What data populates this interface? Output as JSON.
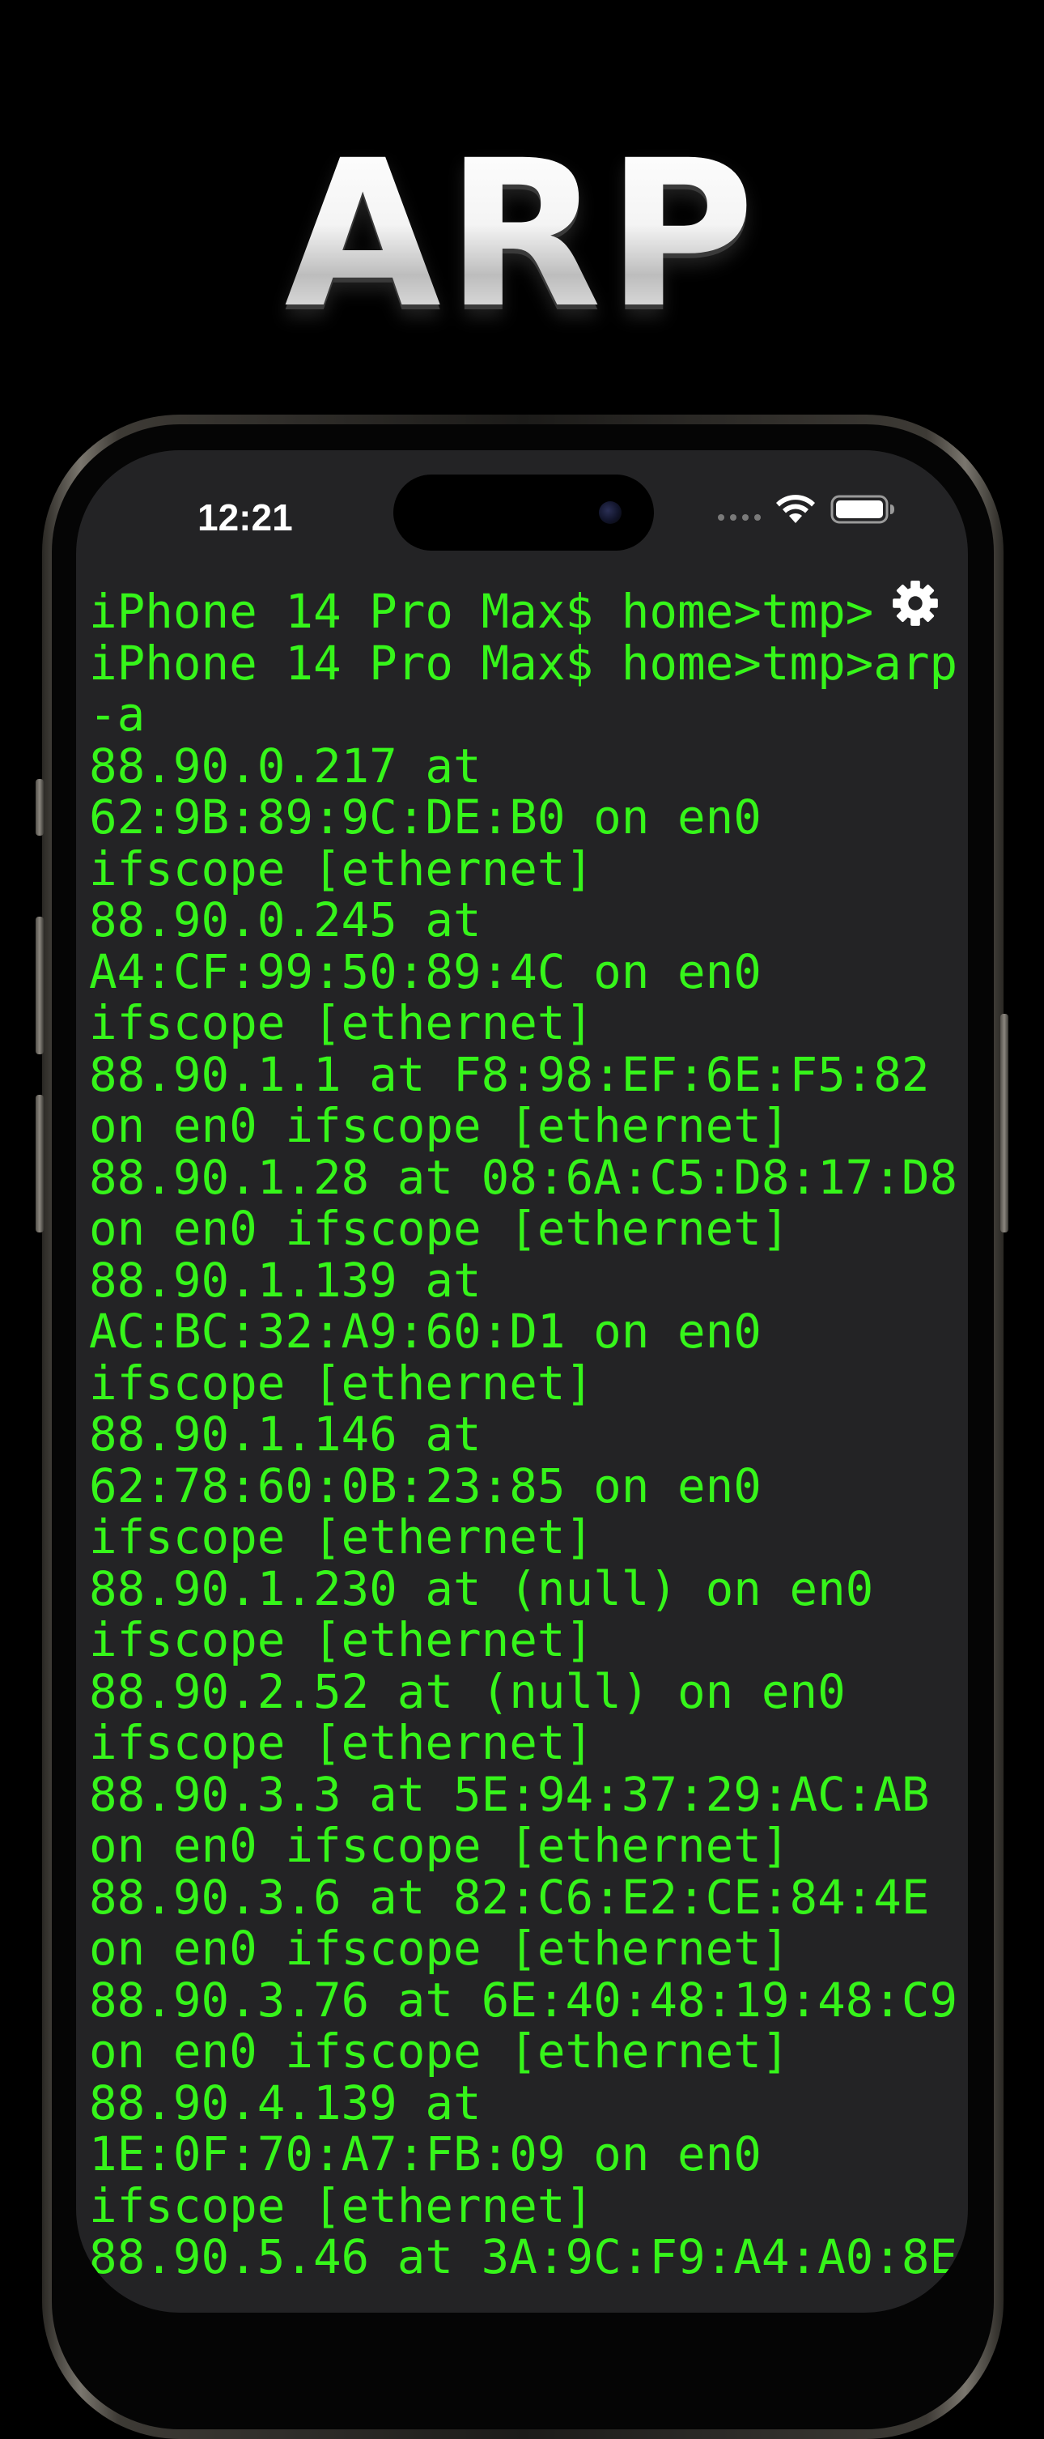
{
  "banner": {
    "title": "ARP"
  },
  "status_bar": {
    "time": "12:21",
    "icons": [
      "cellular-dots-icon",
      "wifi-icon",
      "battery-icon"
    ]
  },
  "toolbar": {
    "settings_icon": "gear-icon"
  },
  "terminal": {
    "text_color": "#36f51a",
    "background": "#232325",
    "lines": [
      "iPhone 14 Pro Max$ home>tmp>",
      "iPhone 14 Pro Max$ home>tmp>arp",
      "-a",
      "88.90.0.217 at",
      "62:9B:89:9C:DE:B0 on en0",
      "ifscope [ethernet]",
      "88.90.0.245 at",
      "A4:CF:99:50:89:4C on en0",
      "ifscope [ethernet]",
      "88.90.1.1 at F8:98:EF:6E:F5:82",
      "on en0 ifscope [ethernet]",
      "88.90.1.28 at 08:6A:C5:D8:17:D8",
      "on en0 ifscope [ethernet]",
      "88.90.1.139 at",
      "AC:BC:32:A9:60:D1 on en0",
      "ifscope [ethernet]",
      "88.90.1.146 at",
      "62:78:60:0B:23:85 on en0",
      "ifscope [ethernet]",
      "88.90.1.230 at (null) on en0",
      "ifscope [ethernet]",
      "88.90.2.52 at (null) on en0",
      "ifscope [ethernet]",
      "88.90.3.3 at 5E:94:37:29:AC:AB",
      "on en0 ifscope [ethernet]",
      "88.90.3.6 at 82:C6:E2:CE:84:4E",
      "on en0 ifscope [ethernet]",
      "88.90.3.76 at 6E:40:48:19:48:C9",
      "on en0 ifscope [ethernet]",
      "88.90.4.139 at",
      "1E:0F:70:A7:FB:09 on en0",
      "ifscope [ethernet]",
      "88.90.5.46 at 3A:9C:F9:A4:A0:8E"
    ]
  }
}
